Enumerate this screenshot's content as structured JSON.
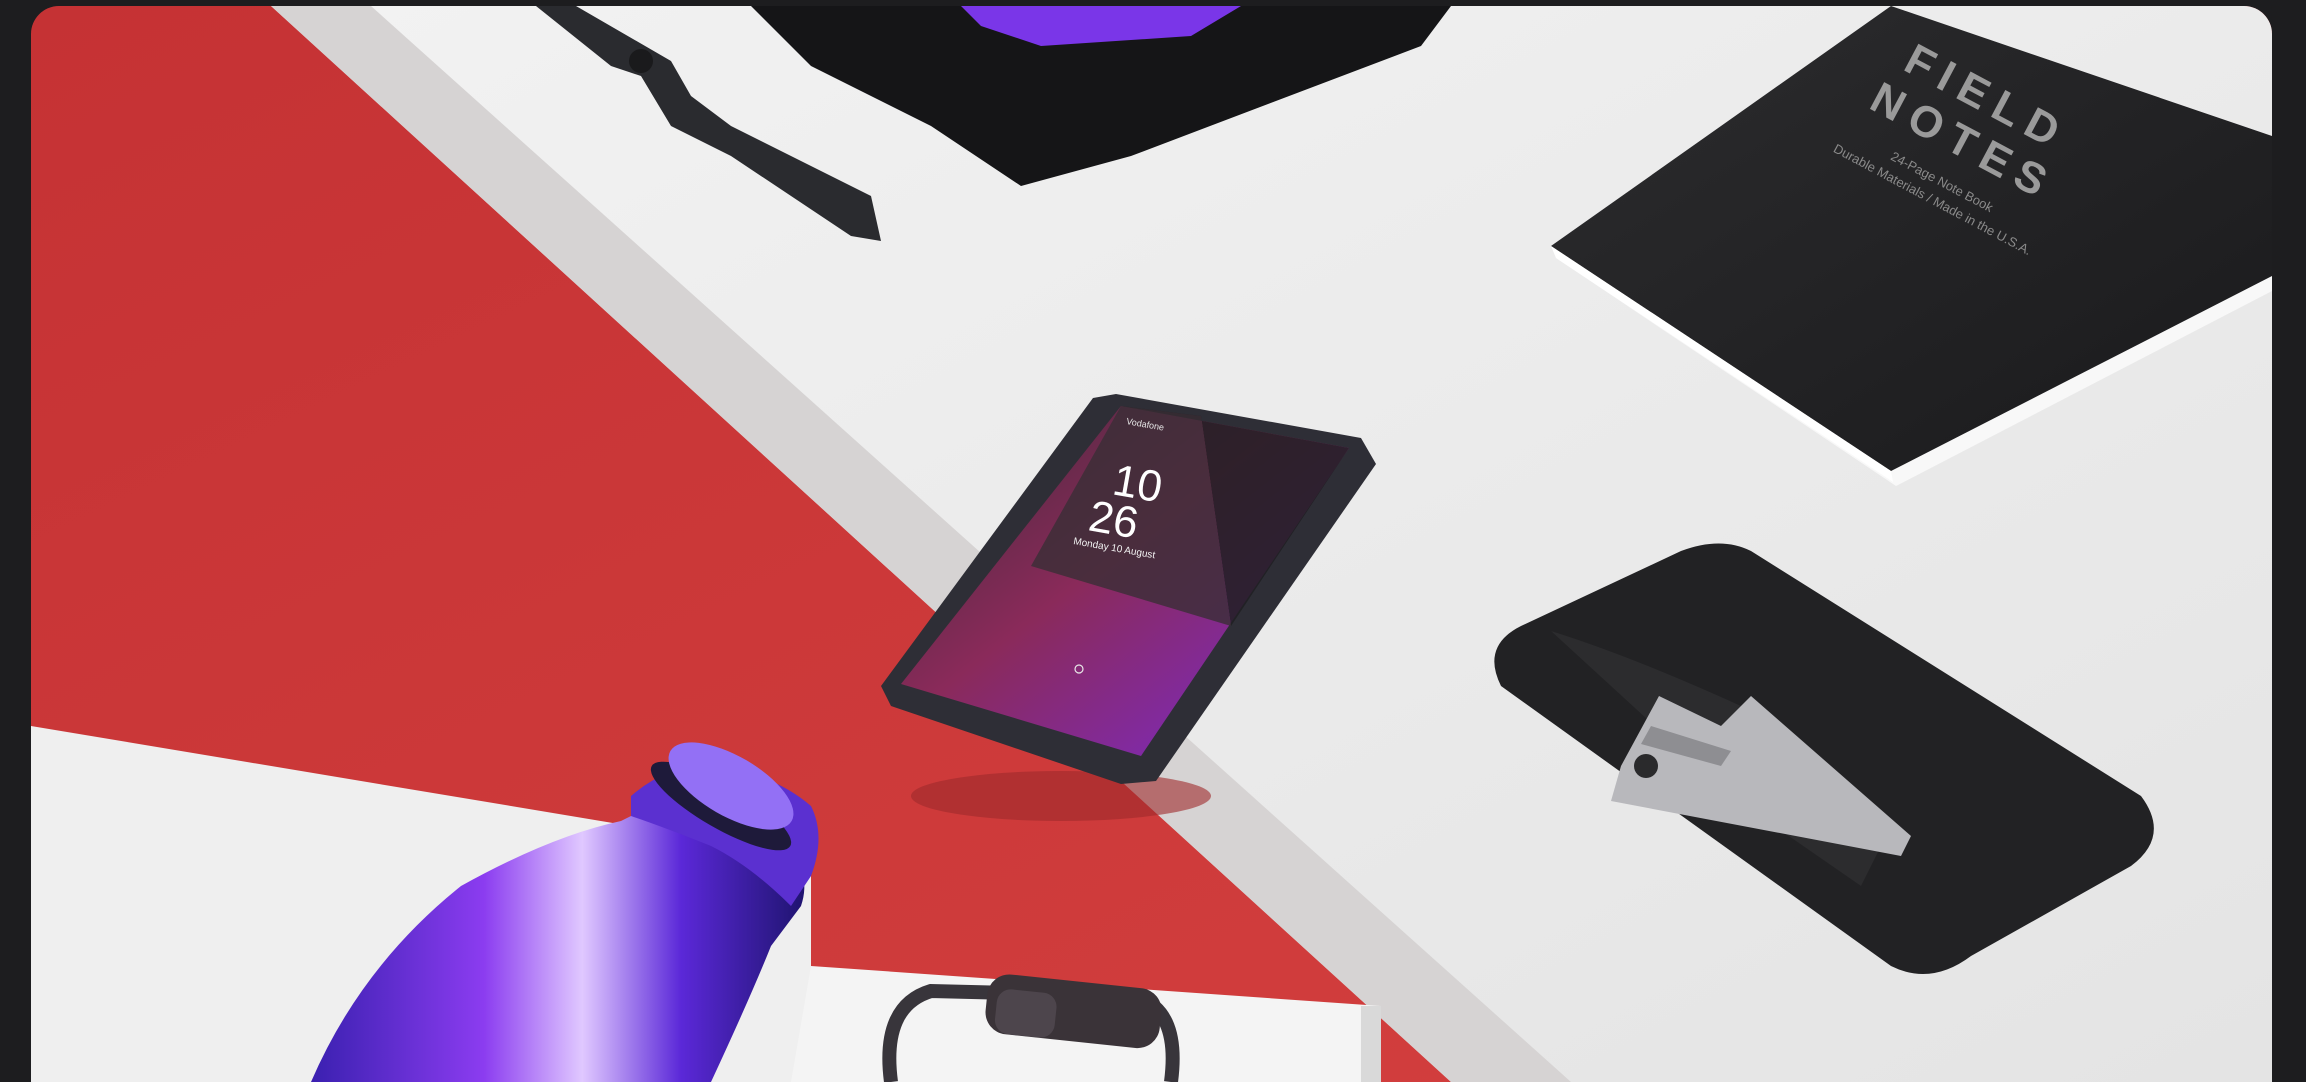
{
  "scene": {
    "description_hidden": "",
    "colors": {
      "frame_bg": "#1d1d1f",
      "red_surface": "#c8383a",
      "white_surface": "#ececec",
      "phone_body": "#3a3a44",
      "notebook": "#232325",
      "wallet": "#2a2a2c",
      "bottle_accent": "#7a3df0"
    },
    "phone": {
      "carrier": "Vodafone",
      "hour": "10",
      "minute": "26",
      "date": "Monday 10 August"
    },
    "notebook": {
      "brand_line1": "FIELD",
      "brand_line2": "NOTES",
      "tagline1": "24-Page Note Book",
      "tagline2": "Durable Materials / Made in the U.S.A."
    }
  }
}
